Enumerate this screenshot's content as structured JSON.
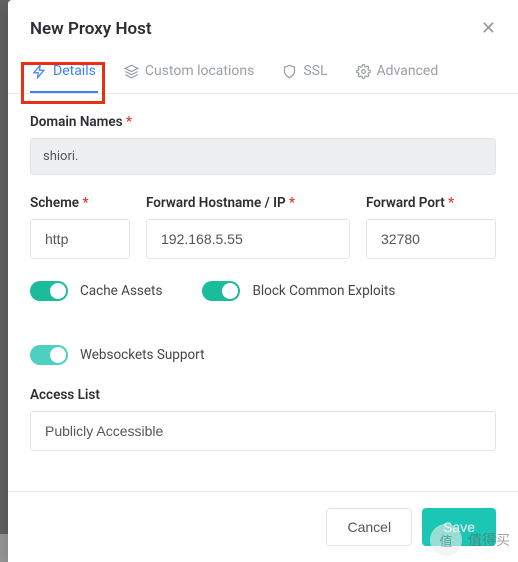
{
  "modal": {
    "title": "New Proxy Host"
  },
  "tabs": {
    "details": "Details",
    "custom": "Custom locations",
    "ssl": "SSL",
    "advanced": "Advanced"
  },
  "labels": {
    "domain": "Domain Names",
    "scheme": "Scheme",
    "hostname": "Forward Hostname / IP",
    "port": "Forward Port",
    "access": "Access List"
  },
  "values": {
    "domain": "shiori.",
    "scheme": "http",
    "hostname": "192.168.5.55",
    "port": "32780",
    "access": "Publicly Accessible"
  },
  "toggles": {
    "cache": "Cache Assets",
    "block": "Block Common Exploits",
    "ws": "Websockets Support"
  },
  "buttons": {
    "cancel": "Cancel",
    "save": "Save"
  },
  "watermark": {
    "icon": "值",
    "text": "值得买"
  },
  "bg": {
    "url": "http://192.168.5.55:32888",
    "c1": "Custom",
    "c2": "Publ"
  }
}
